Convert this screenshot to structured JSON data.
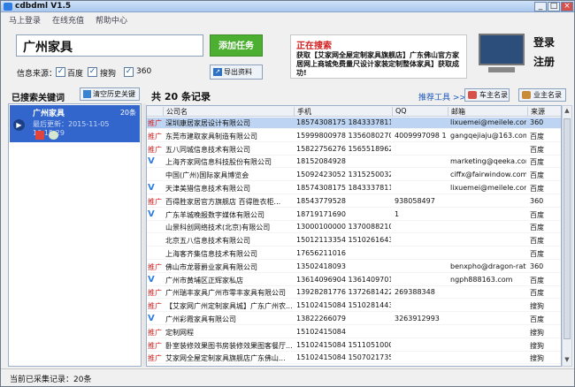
{
  "window": {
    "title": "cdbdml V1.5",
    "min": "_",
    "max": "□",
    "close": "×"
  },
  "menu": [
    "马上登录",
    "在线充值",
    "帮助中心"
  ],
  "search": {
    "value": "广州家具",
    "add_button": "添加任务",
    "source_label": "信息来源：",
    "sources": [
      {
        "label": "百度",
        "checked": true
      },
      {
        "label": "搜狗",
        "checked": true
      },
      {
        "label": "360",
        "checked": true
      }
    ],
    "export_button": "导出资料"
  },
  "promo": {
    "head": "正在搜索",
    "body": "获取【艾家网全屋定制家具旗舰店】广东佛山官方家居网上商城免费量尺设计家装定制整体家具】获取成功!"
  },
  "account": {
    "login": "登录",
    "register": "注册"
  },
  "history": {
    "label": "已搜索关键词",
    "clear_button": "清空历史关键",
    "items": [
      {
        "keyword": "广州家具",
        "count": "20条",
        "updated": "最后更新：2015-11-05 10:15:29"
      }
    ]
  },
  "results": {
    "count_text": "共 20 条记录",
    "tools": "推荐工具 >>",
    "btn_car": "车主名录",
    "btn_owner": "业主名录"
  },
  "table": {
    "columns": [
      "公司名",
      "手机",
      "QQ",
      "邮箱",
      "来源"
    ],
    "rows": [
      {
        "tag": "推广",
        "company": "深圳康居家居设计有限公司",
        "phone": "18574308175  18433378115",
        "qq": "",
        "email": "lixuemei@meilele.com",
        "source": "360",
        "selected": true
      },
      {
        "tag": "推广",
        "company": "东莞市建取家具制造有限公司",
        "phone": "15999800978  13560802709  ...",
        "qq": "4009997098  1052...",
        "email": "gangqejiaju@163.com",
        "source": "百度"
      },
      {
        "tag": "推广",
        "company": "五八同城信息技术有限公司",
        "phone": "15822756276  15655189620  ...",
        "qq": "",
        "email": "",
        "source": "百度"
      },
      {
        "tag": "V",
        "company": "上海齐家网信息科技股份有限公司",
        "phone": "18152084928",
        "qq": "",
        "email": "marketing@qeeka.com  tg...",
        "source": "百度"
      },
      {
        "tag": "",
        "company": "中国(广州)国际家具博览会",
        "phone": "15092423052  13152500325  ...",
        "qq": "",
        "email": "ciffx@fairwindow.com...",
        "source": "百度"
      },
      {
        "tag": "V",
        "company": "天津美猎信息技术有限公司",
        "phone": "18574308175  18433378115",
        "qq": "",
        "email": "lixuemei@meilele.com",
        "source": "百度"
      },
      {
        "tag": "推广",
        "company": "百得胜家居官方旗舰店  百得胜衣柜...",
        "phone": "18543779528",
        "qq": "938058497",
        "email": "",
        "source": "360"
      },
      {
        "tag": "V",
        "company": "广东羊城晚报数字媒体有限公司",
        "phone": "18719171690",
        "qq": "1",
        "email": "",
        "source": "百度"
      },
      {
        "tag": "",
        "company": "山景科创网络技术(北京)有限公司",
        "phone": "13000100000  13700882109",
        "qq": "",
        "email": "",
        "source": "百度"
      },
      {
        "tag": "",
        "company": "北京五八信息技术有限公司",
        "phone": "15012113354  15102616430  ...",
        "qq": "",
        "email": "",
        "source": "百度"
      },
      {
        "tag": "",
        "company": "上海客齐集信息技术有限公司",
        "phone": "17656211016",
        "qq": "",
        "email": "",
        "source": "百度"
      },
      {
        "tag": "推广",
        "company": "佛山市龙蓉爵业家具有限公司",
        "phone": "13502418093",
        "qq": "",
        "email": "benxpho@dragon-rattan...",
        "source": "360"
      },
      {
        "tag": "V",
        "company": "广州市黄埔区正辉家私店",
        "phone": "13614096904  13614097017  ...",
        "qq": "",
        "email": "ngph888163.com",
        "source": "百度"
      },
      {
        "tag": "推广",
        "company": "广州瑞丰家具广州市零丰家具有限公司",
        "phone": "13928281776  13726814229",
        "qq": "269388348",
        "email": "",
        "source": "百度"
      },
      {
        "tag": "推广",
        "company": "【艾家网广州定制家具城】广东广州农...",
        "phone": "15102415084  15102814434  ...",
        "qq": "",
        "email": "",
        "source": "搜狗"
      },
      {
        "tag": "V",
        "company": "广州彩霞家具有限公司",
        "phone": "13822266079",
        "qq": "3263912993",
        "email": "",
        "source": "百度"
      },
      {
        "tag": "推广",
        "company": "定制网程",
        "phone": "15102415084",
        "qq": "",
        "email": "",
        "source": "搜狗"
      },
      {
        "tag": "推广",
        "company": "卧室装修效果图书房装修效果图客餐厅...",
        "phone": "15102415084  15110510004  ...",
        "qq": "",
        "email": "",
        "source": "搜狗"
      },
      {
        "tag": "推广",
        "company": "艾家网全屋定制家具旗舰店广东佛山...",
        "phone": "15102415084  15070217351",
        "qq": "",
        "email": "",
        "source": "搜狗"
      }
    ]
  },
  "status": "当前已采集记录：20条",
  "colors": {
    "accent": "#3366cc",
    "green": "#4caf31",
    "promo_head": "#d02020"
  }
}
